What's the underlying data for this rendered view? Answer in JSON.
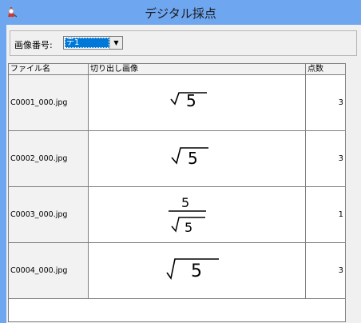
{
  "window": {
    "title": "デジタル採点"
  },
  "toolbar": {
    "image_number_label": "画像番号:",
    "image_number_value": "テ1"
  },
  "table": {
    "columns": [
      "ファイル名",
      "切り出し画像",
      "点数"
    ],
    "rows": [
      {
        "file": "C0001_000.jpg",
        "image_text": "√5",
        "score": "3"
      },
      {
        "file": "C0002_000.jpg",
        "image_text": "√5",
        "score": "3"
      },
      {
        "file": "C0003_000.jpg",
        "image_text": "5/√5",
        "score": "1"
      },
      {
        "file": "C0004_000.jpg",
        "image_text": "√5",
        "score": "3"
      }
    ]
  }
}
